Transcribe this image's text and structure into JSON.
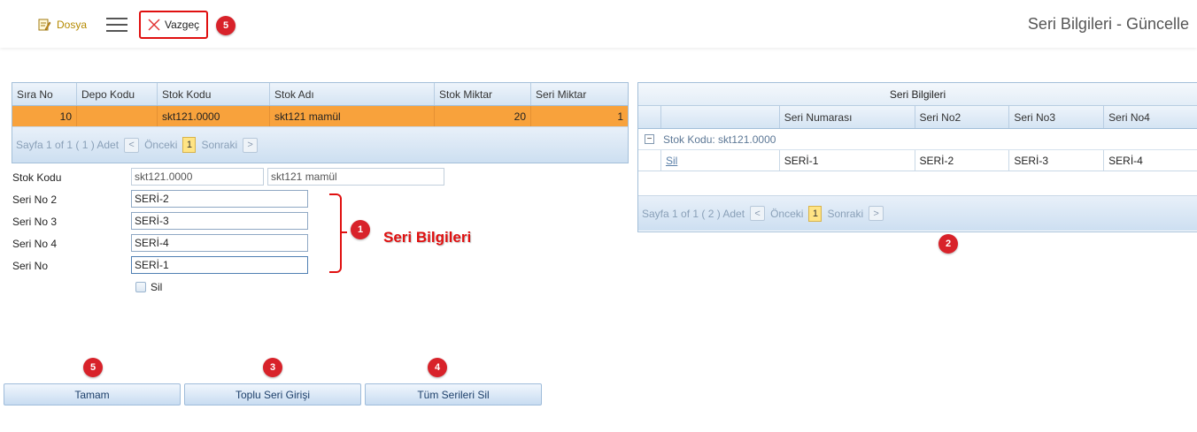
{
  "toolbar": {
    "dosya_label": "Dosya",
    "vazgec_label": "Vazgeç",
    "page_title": "Seri Bilgileri - Güncelle"
  },
  "badges": [
    "5",
    "1",
    "2",
    "5",
    "3",
    "4"
  ],
  "stock_grid": {
    "columns": [
      "Sıra No",
      "Depo Kodu",
      "Stok Kodu",
      "Stok Adı",
      "Stok Miktar",
      "Seri Miktar"
    ],
    "rows": [
      {
        "sira_no": "10",
        "depo_kodu": "",
        "stok_kodu": "skt121.0000",
        "stok_adi": "skt121 mamül",
        "stok_miktar": "20",
        "seri_miktar": "1"
      }
    ],
    "pager": {
      "text": "Sayfa 1 of 1 ( 1 ) Adet",
      "prev": "Önceki",
      "page": "1",
      "next": "Sonraki"
    }
  },
  "form": {
    "stok_kodu_label": "Stok Kodu",
    "stok_kodu_value": "skt121.0000",
    "stok_adi_value": "skt121 mamül",
    "seri_no2_label": "Seri No 2",
    "seri_no2_value": "SERİ-2",
    "seri_no3_label": "Seri No 3",
    "seri_no3_value": "SERİ-3",
    "seri_no4_label": "Seri No 4",
    "seri_no4_value": "SERİ-4",
    "seri_no_label": "Seri No",
    "seri_no_value": "SERİ-1",
    "sil_label": "Sil",
    "annotation": "Seri Bilgileri"
  },
  "serial_grid": {
    "caption": "Seri Bilgileri",
    "columns": [
      "",
      "",
      "Seri Numarası",
      "Seri No2",
      "Seri No3",
      "Seri No4"
    ],
    "group_label": "Stok Kodu: skt121.0000",
    "group_toggle": "−",
    "rows": [
      {
        "action": "Sil",
        "seri_numarasi": "SERİ-1",
        "seri_no2": "SERİ-2",
        "seri_no3": "SERİ-3",
        "seri_no4": "SERİ-4"
      }
    ],
    "pager": {
      "text": "Sayfa 1 of 1 ( 2 ) Adet",
      "prev": "Önceki",
      "page": "1",
      "next": "Sonraki"
    }
  },
  "actions": {
    "tamam": "Tamam",
    "toplu": "Toplu Seri Girişi",
    "tum_sil": "Tüm Serileri Sil"
  },
  "colors": {
    "selected_row": "#f8a23c",
    "annotation_red": "#e01010",
    "header_blue": "#d5e4f3"
  },
  "icons": {
    "dosya": "edit-document-icon",
    "menu": "hamburger-menu-icon",
    "vazgec": "close-x-icon"
  }
}
